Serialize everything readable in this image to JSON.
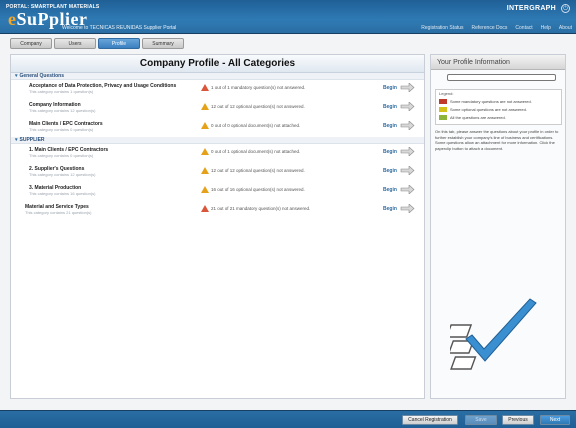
{
  "header": {
    "product_line": "PORTAL: SMARTPLANT MATERIALS",
    "logo_text": "eSuPplier",
    "welcome": "Welcome to TECNICAS REUNIDAS Supplier Portal",
    "brand": "INTERGRAPH",
    "nav": [
      "Registration Status",
      "Reference Docs",
      "Contact",
      "Help",
      "About"
    ]
  },
  "tabs": [
    {
      "label": "Company",
      "active": false
    },
    {
      "label": "Users",
      "active": false
    },
    {
      "label": "Profile",
      "active": true
    },
    {
      "label": "Summary",
      "active": false
    }
  ],
  "main": {
    "title": "Company Profile - All Categories",
    "sections": [
      {
        "label": "General Questions",
        "rows": [
          {
            "title": "Acceptance of Data Protection, Privacy and Usage Conditions",
            "subtitle": "This category contains 1 question(s)",
            "status": "1 out of 1 mandatory question(s) not answered.",
            "severity": "mandatory",
            "action": "Begin"
          },
          {
            "title": "Company Information",
            "subtitle": "This category contains 12 question(s)",
            "status": "12 out of 12 optional question(s) not answered.",
            "severity": "optional",
            "action": "Begin"
          },
          {
            "title": "Main Clients / EPC Contractors",
            "subtitle": "This category contains 0 question(s)",
            "status": "0 out of 0 optional document(s) not attached.",
            "severity": "optional",
            "action": "Begin"
          }
        ]
      },
      {
        "label": "SUPPLIER",
        "rows": [
          {
            "title": "1. Main Clients / EPC Contractors",
            "subtitle": "This category contains 0 question(s)",
            "status": "0 out of 1 optional document(s) not attached.",
            "severity": "optional",
            "action": "Begin"
          },
          {
            "title": "2. Supplier's Questions",
            "subtitle": "This category contains 12 question(s)",
            "status": "12 out of 12 optional question(s) not answered.",
            "severity": "optional",
            "action": "Begin"
          },
          {
            "title": "3. Material Production",
            "subtitle": "This category contains 16 question(s)",
            "status": "16 out of 16 optional question(s) not answered.",
            "severity": "optional",
            "action": "Begin"
          }
        ]
      },
      {
        "label": "",
        "rows": [
          {
            "title": "Material and Service Types",
            "subtitle": "This category contains 21 question(s)",
            "status": "21 out of 21 mandatory question(s) not answered.",
            "severity": "mandatory",
            "action": "Begin"
          }
        ]
      }
    ]
  },
  "sidebar": {
    "title": "Your Profile Information",
    "progress": 0,
    "legend_title": "Legend:",
    "legend": [
      {
        "text": "Some mandatory questions are not answered.",
        "color": "#c0392b"
      },
      {
        "text": "Some optional questions are not answered.",
        "color": "#d4c21a"
      },
      {
        "text": "All the questions are answered.",
        "color": "#8fb43a"
      }
    ],
    "paragraph": "On this tab, please answer the questions about your profile in order to further establish your company's line of business and certifications. Some questions allow an attachment for more information. Click the paperclip button to attach a document."
  },
  "footer": {
    "cancel": "Cancel Registration",
    "save": "Save",
    "previous": "Previous",
    "next": "Next"
  },
  "colors": {
    "accent": "#2f7ab4",
    "warning": "#e6a11a",
    "mandatory": "#d9563a"
  }
}
